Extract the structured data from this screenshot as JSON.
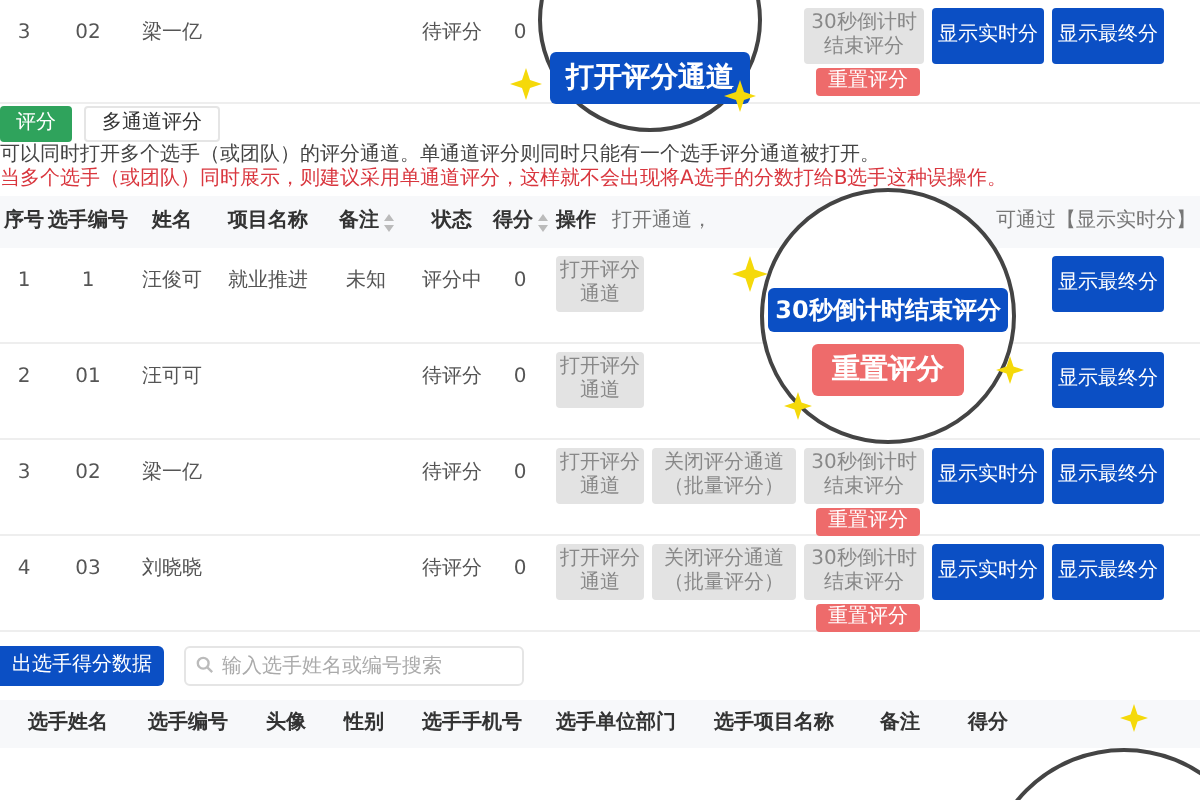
{
  "top_row": {
    "cells": [
      "3",
      "02",
      "梁一亿",
      "",
      "",
      "待评分",
      "0"
    ],
    "actions": [
      {
        "kind": "covered"
      },
      {
        "kind": "covered"
      },
      {
        "kind": "gray",
        "label": "30秒倒计时结束评分"
      },
      {
        "kind": "blue",
        "label": "显示实时分"
      },
      {
        "kind": "blue",
        "label": "显示最终分"
      }
    ],
    "reset": "重置评分"
  },
  "tabs": [
    {
      "label": "评分",
      "selected": true
    },
    {
      "label": "多通道评分",
      "selected": false
    }
  ],
  "notes": [
    {
      "text": "可以同时打开多个选手（或团队）的评分通道。单通道评分则同时只能有一个选手评分通道被打开。",
      "kind": "info"
    },
    {
      "text": "当多个选手（或团队）同时展示，则建议采用单通道评分，这样就不会出现将A选手的分数打给B选手这种误操作。",
      "kind": "warning"
    }
  ],
  "table": {
    "columns": [
      "序号",
      "选手编号",
      "姓名",
      "项目名称",
      "备注",
      "状态",
      "得分",
      "操作"
    ],
    "hint_left": "打开通道，",
    "hint_right": "可通过【显示实时分】",
    "rows": [
      {
        "cells": [
          "1",
          "1",
          "汪俊可",
          "就业推进",
          "未知",
          "评分中",
          "0"
        ],
        "actions": [
          {
            "kind": "gray",
            "label": "打开评分通道"
          },
          {
            "kind": "covered"
          },
          {
            "kind": "covered"
          },
          {
            "kind": "covered"
          },
          {
            "kind": "blue",
            "label": "显示最终分"
          }
        ]
      },
      {
        "cells": [
          "2",
          "01",
          "汪可可",
          "",
          "",
          "待评分",
          "0"
        ],
        "actions": [
          {
            "kind": "gray",
            "label": "打开评分通道"
          },
          {
            "kind": "covered"
          },
          {
            "kind": "covered"
          },
          {
            "kind": "covered"
          },
          {
            "kind": "blue",
            "label": "显示最终分"
          }
        ]
      },
      {
        "cells": [
          "3",
          "02",
          "梁一亿",
          "",
          "",
          "待评分",
          "0"
        ],
        "actions": [
          {
            "kind": "gray",
            "label": "打开评分通道"
          },
          {
            "kind": "gray",
            "label": "关闭评分通道（批量评分）"
          },
          {
            "kind": "gray",
            "label": "30秒倒计时结束评分"
          },
          {
            "kind": "blue",
            "label": "显示实时分"
          },
          {
            "kind": "blue",
            "label": "显示最终分"
          }
        ],
        "reset": "重置评分"
      },
      {
        "cells": [
          "4",
          "03",
          "刘晓晓",
          "",
          "",
          "待评分",
          "0"
        ],
        "actions": [
          {
            "kind": "gray",
            "label": "打开评分通道"
          },
          {
            "kind": "gray",
            "label": "关闭评分通道（批量评分）"
          },
          {
            "kind": "gray",
            "label": "30秒倒计时结束评分"
          },
          {
            "kind": "blue",
            "label": "显示实时分"
          },
          {
            "kind": "blue",
            "label": "显示最终分"
          }
        ],
        "reset": "重置评分"
      }
    ]
  },
  "export_button": "出选手得分数据",
  "search": {
    "placeholder": "输入选手姓名或编号搜索"
  },
  "score_table": {
    "columns": [
      "选手姓名",
      "选手编号",
      "头像",
      "性别",
      "选手手机号",
      "选手单位部门",
      "选手项目名称",
      "备注",
      "得分"
    ]
  },
  "magnifiers": [
    {
      "button": "打开评分通道"
    },
    {
      "button": "30秒倒计时结束评分",
      "reset": "重置评分"
    }
  ]
}
